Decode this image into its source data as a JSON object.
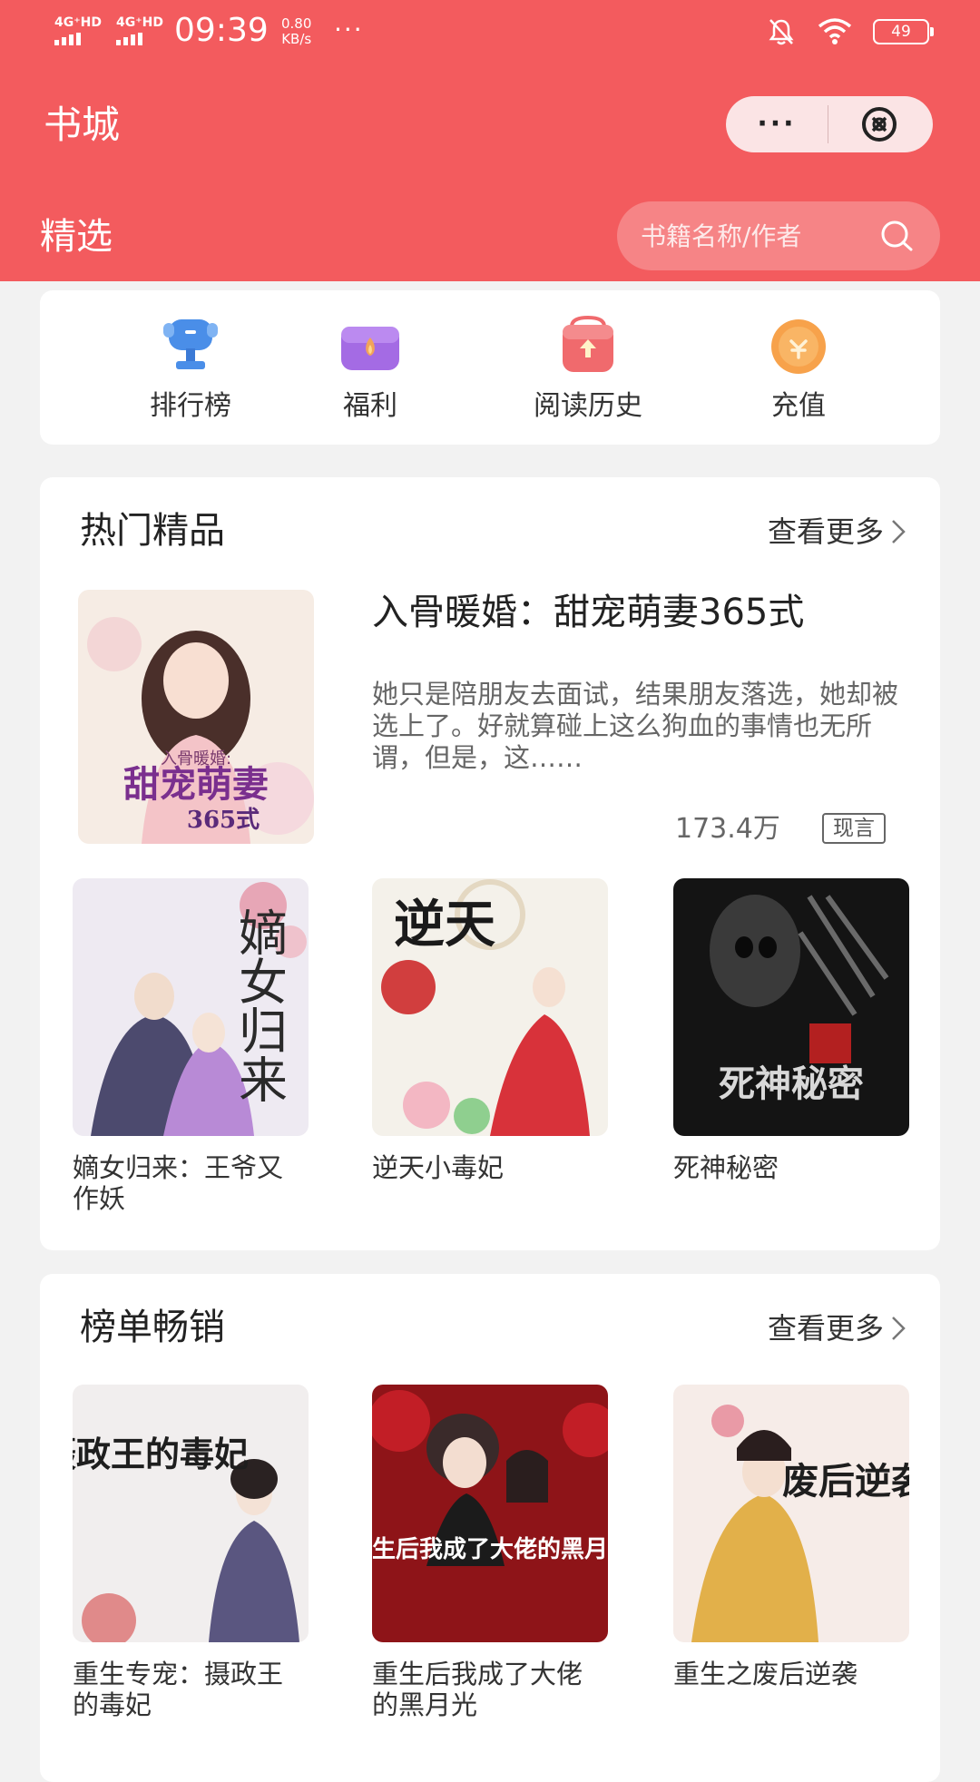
{
  "status_bar": {
    "signal1": "4G⁺HD",
    "signal2": "4G⁺HD",
    "time": "09:39",
    "speed_value": "0.80",
    "speed_unit": "KB/s",
    "dots": "···",
    "battery": "49"
  },
  "header": {
    "title": "书城",
    "capsule_more": "···",
    "tab": "精选",
    "search_placeholder": "书籍名称/作者"
  },
  "quick_nav": [
    {
      "label": "排行榜",
      "icon": "trophy-icon"
    },
    {
      "label": "福利",
      "icon": "gift-box-icon"
    },
    {
      "label": "阅读历史",
      "icon": "history-bag-icon"
    },
    {
      "label": "充值",
      "icon": "coin-icon"
    }
  ],
  "hot": {
    "title": "热门精品",
    "more": "查看更多",
    "featured": {
      "title": "入骨暖婚：甜宠萌妻365式",
      "desc": "她只是陪朋友去面试，结果朋友落选，她却被选上了。好就算碰上这么狗血的事情也无所谓，但是，这……",
      "count": "173.4万",
      "tag": "现言",
      "cover_text_top": "入骨暖婚:",
      "cover_text_main": "甜宠萌妻",
      "cover_text_sub": "365式"
    },
    "books": [
      {
        "title": "嫡女归来：王爷又作妖",
        "cover_text": "嫡女归来"
      },
      {
        "title": "逆天小毒妃",
        "cover_text": "逆天"
      },
      {
        "title": "死神秘密",
        "cover_text": "死神秘密"
      }
    ]
  },
  "bestseller": {
    "title": "榜单畅销",
    "more": "查看更多",
    "books": [
      {
        "title": "重生专宠：摄政王的毒妃",
        "cover_text": "摄政王的毒妃"
      },
      {
        "title": "重生后我成了大佬的黑月光",
        "cover_text": "重生后我成了大佬的黑月光"
      },
      {
        "title": "重生之废后逆袭",
        "cover_text": "废后逆袭"
      }
    ]
  },
  "colors": {
    "brand": "#f35b5e",
    "search_bg": "#f68486",
    "capsule_bg": "#fbe4e5"
  }
}
